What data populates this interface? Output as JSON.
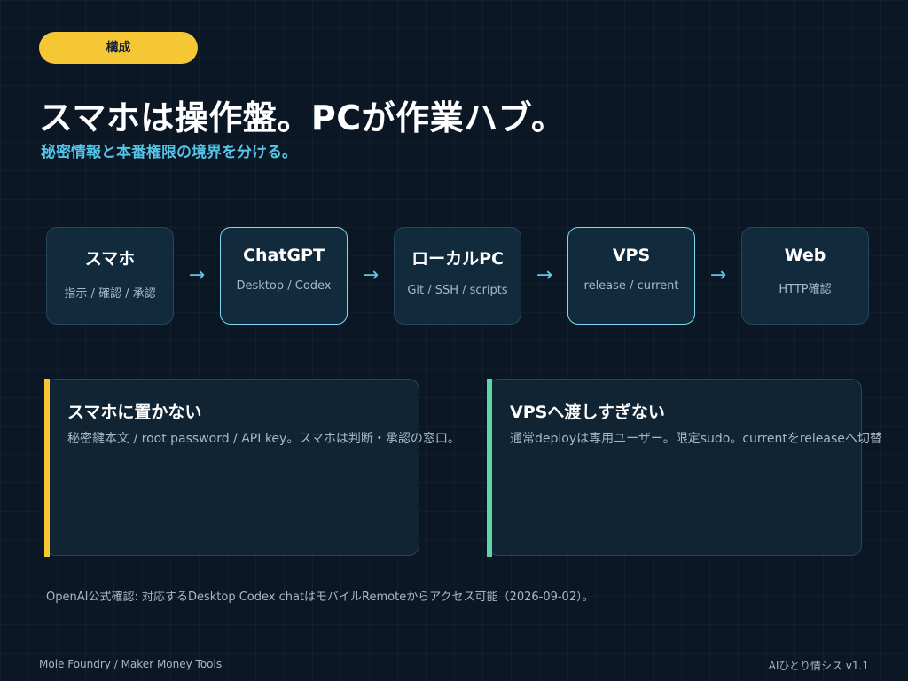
{
  "tag": {
    "label": "構成"
  },
  "header": {
    "title": "スマホは操作盤。PCが作業ハブ。",
    "subtitle": "秘密情報と本番権限の境界を分ける。"
  },
  "flow": {
    "nodes": [
      {
        "title": "スマホ",
        "sub": "指示 / 確認 / 承認"
      },
      {
        "title": "ChatGPT",
        "sub": "Desktop / Codex"
      },
      {
        "title": "ローカルPC",
        "sub": "Git / SSH / scripts"
      },
      {
        "title": "VPS",
        "sub": "release / current"
      },
      {
        "title": "Web",
        "sub": "HTTP確認"
      }
    ],
    "arrow": "→"
  },
  "cards": [
    {
      "title": "スマホに置かない",
      "text": "秘密鍵本文 / root password / API key。スマホは判断・承認の窓口。"
    },
    {
      "title": "VPSへ渡しすぎない",
      "text": "通常deployは専用ユーザー。限定sudo。currentをreleaseへ切替"
    }
  ],
  "note": "OpenAI公式確認: 対応するDesktop Codex chatはモバイルRemoteからアクセス可能（2026-09-02）。",
  "footer": {
    "left": "Mole Foundry / Maker Money Tools",
    "right": "AIひとり情シス v1.1"
  },
  "colors": {
    "background": "#0b1724",
    "tag": "#f6c735",
    "accent": "#54c4e6",
    "card1_bar": "#f6c735",
    "card2_bar": "#5fd6a6"
  }
}
